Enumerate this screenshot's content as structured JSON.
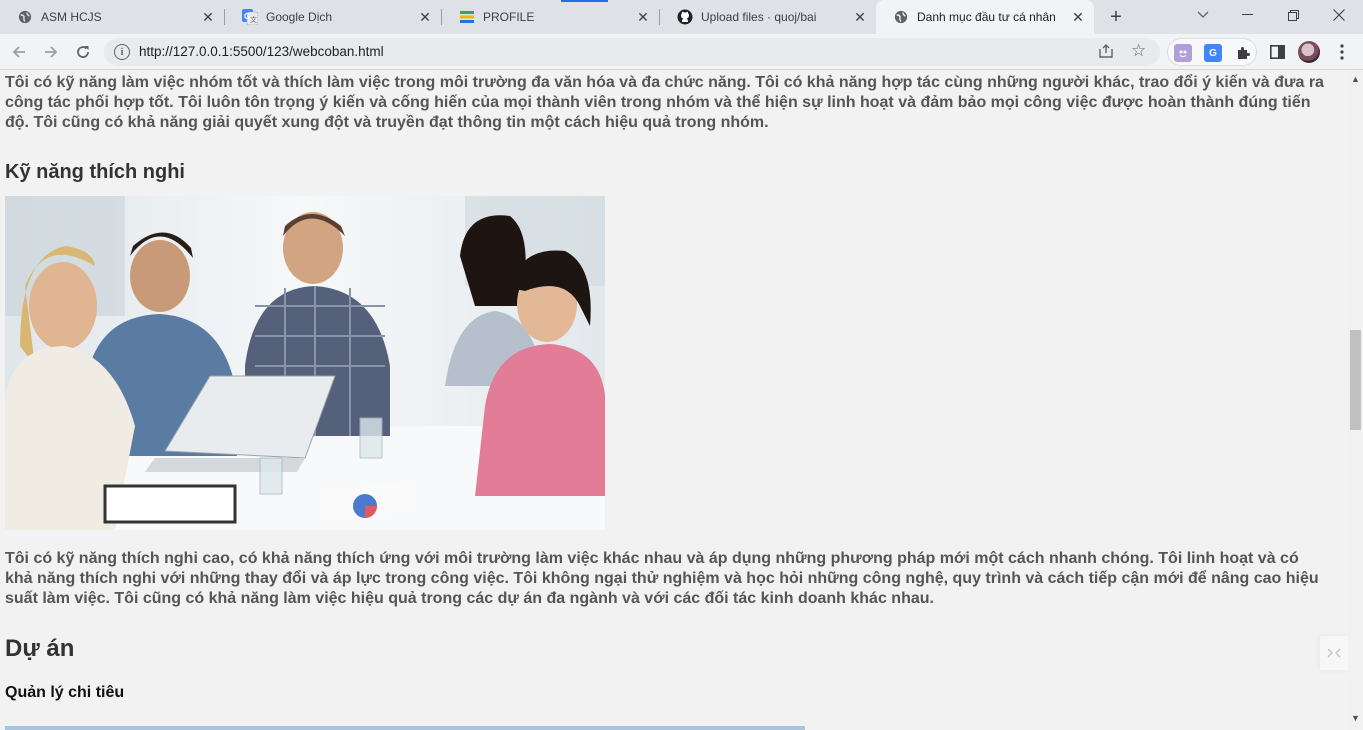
{
  "tabs": [
    {
      "title": "ASM HCJS",
      "icon": "globe-icon",
      "active": false
    },
    {
      "title": "Google Dịch",
      "icon": "google-translate-icon",
      "active": false
    },
    {
      "title": "PROFILE",
      "icon": "profile-logo-icon",
      "active": false
    },
    {
      "title": "Upload files · quoj/bai",
      "icon": "github-icon",
      "active": false
    },
    {
      "title": "Danh mục đầu tư cá nhân",
      "icon": "globe-icon",
      "active": true
    }
  ],
  "toolbar": {
    "url": "http://127.0.0.1:5500/123/webcoban.html"
  },
  "page": {
    "teamwork_paragraph": "Tôi có kỹ năng làm việc nhóm tốt và thích làm việc trong môi trường đa văn hóa và đa chức năng. Tôi có khả năng hợp tác cùng những người khác, trao đổi ý kiến và đưa ra công tác phối hợp tốt. Tôi luôn tôn trọng ý kiến và cống hiến của mọi thành viên trong nhóm và thể hiện sự linh hoạt và đảm bảo mọi công việc được hoàn thành đúng tiến độ. Tôi cũng có khả năng giải quyết xung đột và truyền đạt thông tin một cách hiệu quả trong nhóm.",
    "adaptability_heading": "Kỹ năng thích nghi",
    "adaptability_paragraph": "Tôi có kỹ năng thích nghi cao, có khả năng thích ứng với môi trường làm việc khác nhau và áp dụng những phương pháp mới một cách nhanh chóng. Tôi linh hoạt và có khả năng thích nghi với những thay đổi và áp lực trong công việc. Tôi không ngại thử nghiệm và học hỏi những công nghệ, quy trình và cách tiếp cận mới để nâng cao hiệu suất làm việc. Tôi cũng có khả năng làm việc hiệu quả trong các dự án đa ngành và với các đối tác kinh doanh khác nhau.",
    "projects_heading": "Dự án",
    "project1_title": "Quản lý chi tiêu"
  },
  "colors": {
    "tabstrip": "#dee1e6",
    "toolbar": "#f1f3f4",
    "page_bg": "#f2f2f2",
    "body_text": "#555555",
    "accent": "#1a73e8"
  }
}
